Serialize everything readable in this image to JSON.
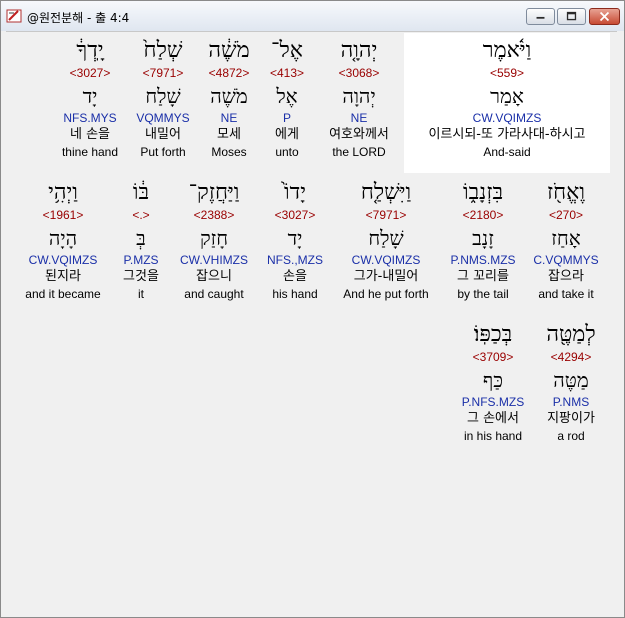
{
  "window": {
    "title": "@원전분해 - 출 4:4",
    "icon": "app-book-icon",
    "controls": [
      "minimize-icon",
      "maximize-icon",
      "close-icon"
    ]
  },
  "rows": [
    {
      "words": [
        {
          "heb": "וַיֹּ֫אמֶר",
          "strong": "<559>",
          "root": "אָמַר",
          "morph": "CW.VQIMZS",
          "kor": "이르시되-또 가라사대-하시고",
          "eng": "And-said"
        },
        {
          "heb": "יְהוָ֤ה",
          "strong": "<3068>",
          "root": "יְהוָה",
          "morph": "NE",
          "kor": "여호와께서",
          "eng": "the LORD"
        },
        {
          "heb": "אֶל־",
          "strong": "<413>",
          "root": "אֶל",
          "morph": "P",
          "kor": "에게",
          "eng": "unto"
        },
        {
          "heb": "מֹשֶׁ֔ה",
          "strong": "<4872>",
          "root": "מֹשֶׁה",
          "morph": "NE",
          "kor": "모세",
          "eng": "Moses"
        },
        {
          "heb": "שְׁלַח֙",
          "strong": "<7971>",
          "root": "שָׁלַח",
          "morph": "VQMMYS",
          "kor": "내밀어",
          "eng": "Put forth"
        },
        {
          "heb": "יָֽדְךָ֔",
          "strong": "<3027>",
          "root": "יָד",
          "morph": "NFS.MYS",
          "kor": "네 손을",
          "eng": "thine hand"
        }
      ]
    },
    {
      "words": [
        {
          "heb": "וֶאֱחֹ֖ז",
          "strong": "<270>",
          "root": "אָחַז",
          "morph": "C.VQMMYS",
          "kor": "잡으라",
          "eng": "and take it"
        },
        {
          "heb": "בִּזְנָב֑וֹ",
          "strong": "<2180>",
          "root": "זָנָב",
          "morph": "P.NMS.MZS",
          "kor": "그 꼬리를",
          "eng": "by the tail"
        },
        {
          "heb": "וַיִּשְׁלַ֤ח",
          "strong": "<7971>",
          "root": "שָׁלַח",
          "morph": "CW.VQIMZS",
          "kor": "그가-내밀어",
          "eng": "And he put forth"
        },
        {
          "heb": "יָדוֹ֙",
          "strong": "<3027>",
          "root": "יָד",
          "morph": "NFS.,MZS",
          "kor": "손을",
          "eng": "his hand"
        },
        {
          "heb": "וַיַּחֲזֶק־",
          "strong": "<2388>",
          "root": "חָזַק",
          "morph": "CW.VHIMZS",
          "kor": "잡으니",
          "eng": "and caught"
        },
        {
          "heb": "בּ֔וֹ",
          "strong": "<.>",
          "root": "בְּ",
          "morph": "P.MZS",
          "kor": "그것을",
          "eng": "it"
        },
        {
          "heb": "וַיְהִ֥י",
          "strong": "<1961>",
          "root": "הָיָה",
          "morph": "CW.VQIMZS",
          "kor": "된지라",
          "eng": "and it became"
        }
      ]
    },
    {
      "words": [
        {
          "heb": "לְמַטֶּ֖ה",
          "strong": "<4294>",
          "root": "מַטֶּה",
          "morph": "P.NMS",
          "kor": "지팡이가",
          "eng": "a rod"
        },
        {
          "heb": "בְּכַפּֽוֹ׃",
          "strong": "<3709>",
          "root": "כַּף",
          "morph": "P.NFS.MZS",
          "kor": "그 손에서",
          "eng": "in his hand"
        }
      ]
    }
  ]
}
